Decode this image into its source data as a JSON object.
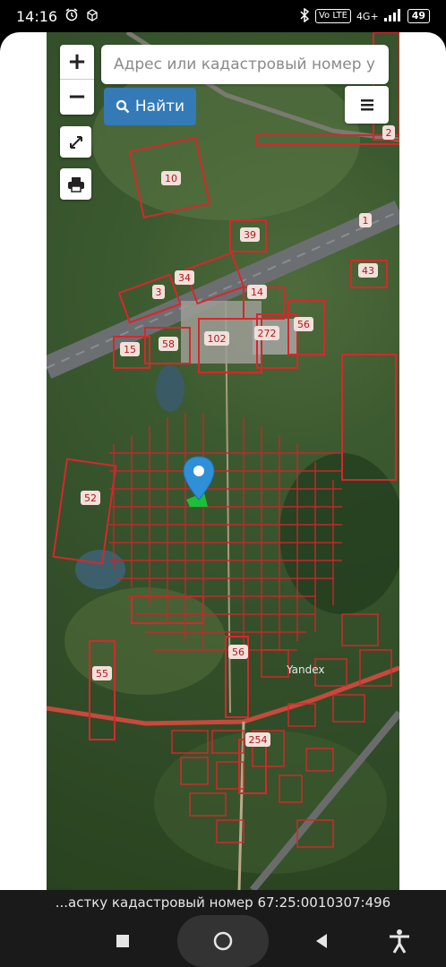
{
  "status_bar": {
    "time": "14:16",
    "network_badge": "Vo LTE",
    "network_type": "4G+",
    "battery": "49"
  },
  "map": {
    "zoom_in_label": "+",
    "zoom_out_label": "−",
    "search_placeholder": "Адрес или кадастровый номер участка",
    "find_button_label": "Найти",
    "provider_label": "Yandex",
    "parcel_labels": [
      "10",
      "39",
      "1",
      "43",
      "34",
      "3",
      "14",
      "15",
      "58",
      "102",
      "272",
      "56",
      "52",
      "55",
      "56",
      "254",
      "2"
    ]
  },
  "toast": {
    "text": "...астку кадастровый номер 67:25:0010307:496"
  },
  "colors": {
    "accent": "#337ab7",
    "parcel_red": "#d9262b"
  }
}
